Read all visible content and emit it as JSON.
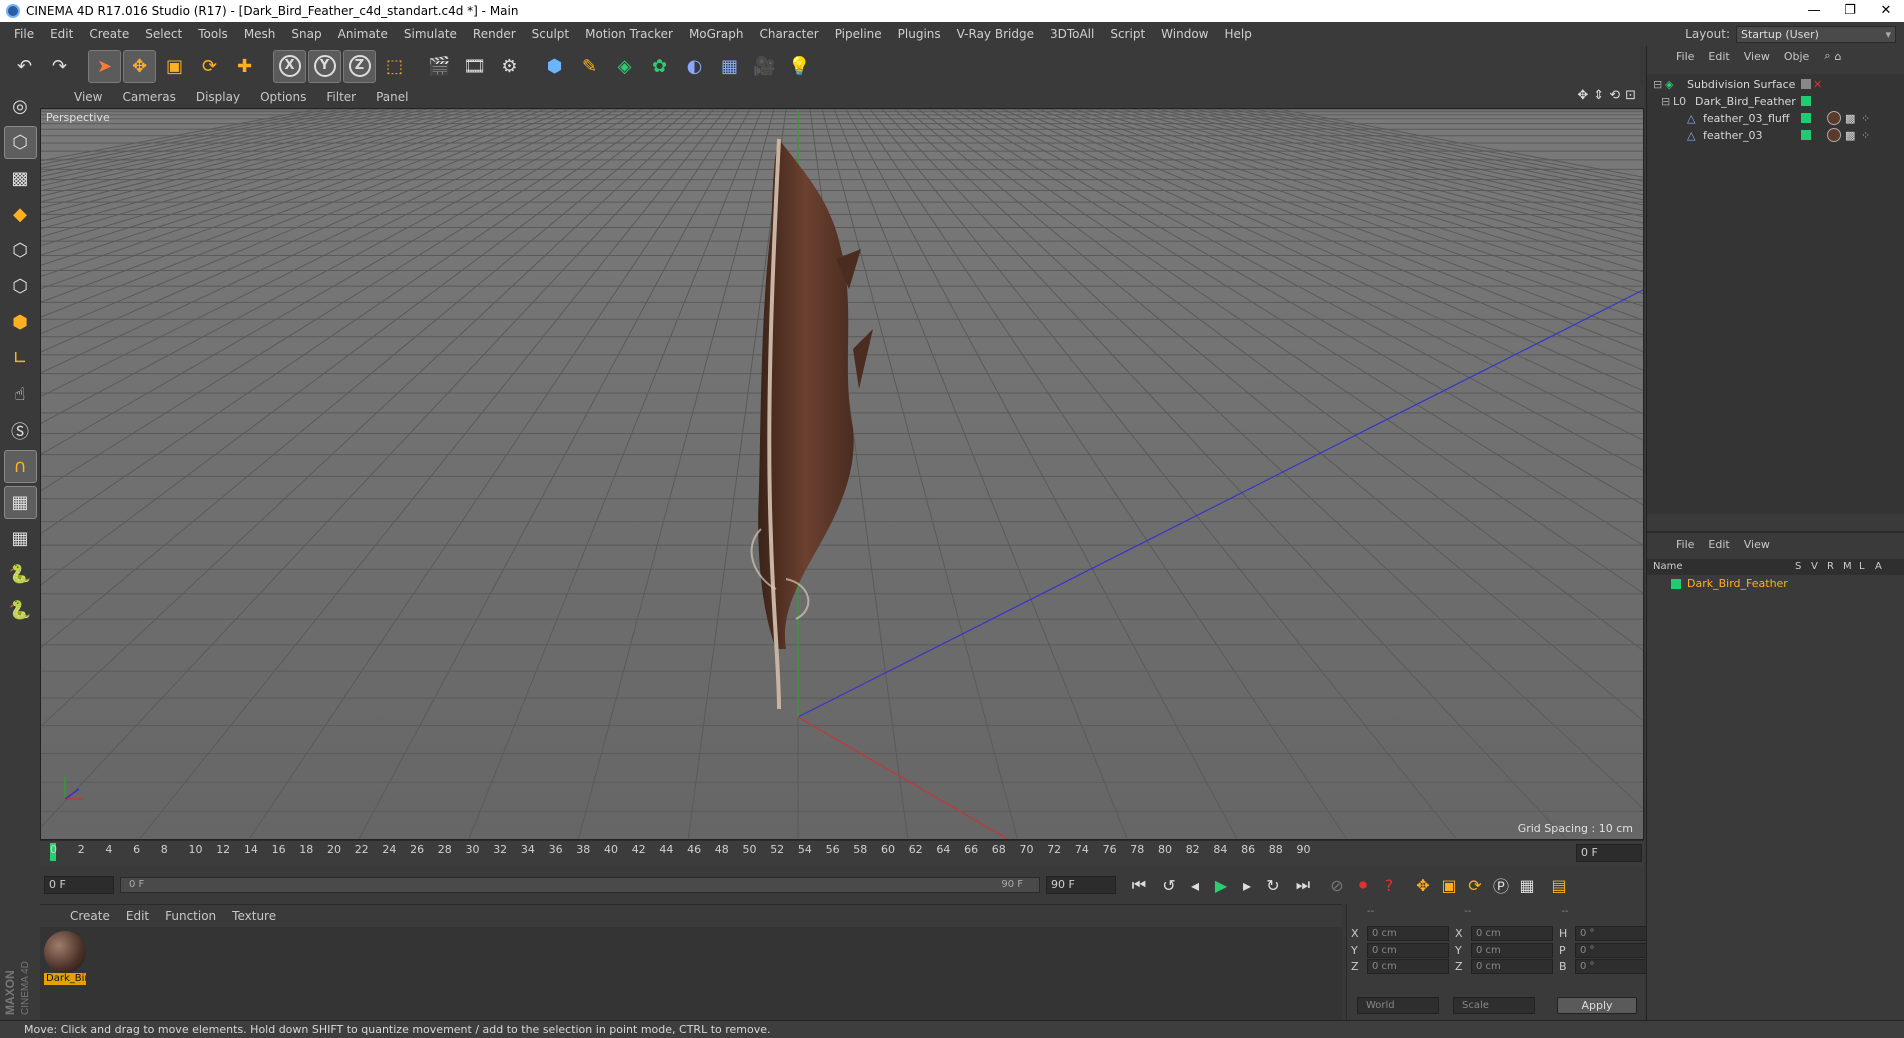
{
  "window": {
    "title": "CINEMA 4D R17.016 Studio (R17) - [Dark_Bird_Feather_c4d_standart.c4d *] - Main",
    "controls": [
      "—",
      "❐",
      "✕"
    ]
  },
  "menubar": {
    "items": [
      "File",
      "Edit",
      "Create",
      "Select",
      "Tools",
      "Mesh",
      "Snap",
      "Animate",
      "Simulate",
      "Render",
      "Sculpt",
      "Motion Tracker",
      "MoGraph",
      "Character",
      "Pipeline",
      "Plugins",
      "V-Ray Bridge",
      "3DToAll",
      "Script",
      "Window",
      "Help"
    ],
    "layout_label": "Layout:",
    "layout_value": "Startup (User)"
  },
  "toolbar": {
    "axis_x": "X",
    "axis_y": "Y",
    "axis_z": "Z"
  },
  "viewport": {
    "menu": [
      "View",
      "Cameras",
      "Display",
      "Options",
      "Filter",
      "Panel"
    ],
    "label": "Perspective",
    "grid_spacing": "Grid Spacing : 10 cm"
  },
  "timeline": {
    "ticks": [
      "0",
      "2",
      "4",
      "6",
      "8",
      "10",
      "12",
      "14",
      "16",
      "18",
      "20",
      "22",
      "24",
      "26",
      "28",
      "30",
      "32",
      "34",
      "36",
      "38",
      "40",
      "42",
      "44",
      "46",
      "48",
      "50",
      "52",
      "54",
      "56",
      "58",
      "60",
      "62",
      "64",
      "66",
      "68",
      "70",
      "72",
      "74",
      "76",
      "78",
      "80",
      "82",
      "84",
      "86",
      "88",
      "90"
    ],
    "current_frame_right": "0 F"
  },
  "transport": {
    "start_field": "0 F",
    "slider_start": "0 F",
    "slider_end": "90 F",
    "end_field": "90 F"
  },
  "material_panel": {
    "menu": [
      "Create",
      "Edit",
      "Function",
      "Texture"
    ],
    "material_name": "Dark_Bir"
  },
  "coordinates": {
    "header": [
      "--",
      "--",
      "--"
    ],
    "rows": [
      {
        "l1": "X",
        "v1": "0 cm",
        "l2": "X",
        "v2": "0 cm",
        "l3": "H",
        "v3": "0 °"
      },
      {
        "l1": "Y",
        "v1": "0 cm",
        "l2": "Y",
        "v2": "0 cm",
        "l3": "P",
        "v3": "0 °"
      },
      {
        "l1": "Z",
        "v1": "0 cm",
        "l2": "Z",
        "v2": "0 cm",
        "l3": "B",
        "v3": "0 °"
      }
    ],
    "mode": "World",
    "transform": "Scale",
    "apply": "Apply"
  },
  "object_manager": {
    "menu": [
      "File",
      "Edit",
      "View",
      "Obje"
    ],
    "objects": [
      {
        "name": "Subdivision Surface",
        "indent": 0
      },
      {
        "name": "Dark_Bird_Feather",
        "indent": 1
      },
      {
        "name": "feather_03_fluff",
        "indent": 2
      },
      {
        "name": "feather_03",
        "indent": 2
      }
    ]
  },
  "attribute_manager": {
    "menu": [
      "File",
      "Edit",
      "View"
    ],
    "columns": [
      "Name",
      "S",
      "V",
      "R",
      "M",
      "L",
      "A"
    ],
    "row_name": "Dark_Bird_Feather"
  },
  "status": {
    "text": "Move: Click and drag to move elements. Hold down SHIFT to quantize movement / add to the selection in point mode, CTRL to remove."
  },
  "colors": {
    "accent_green": "#1ecc72",
    "selection_orange": "#e8a000",
    "viewport_bg": "#6d6d6d"
  }
}
